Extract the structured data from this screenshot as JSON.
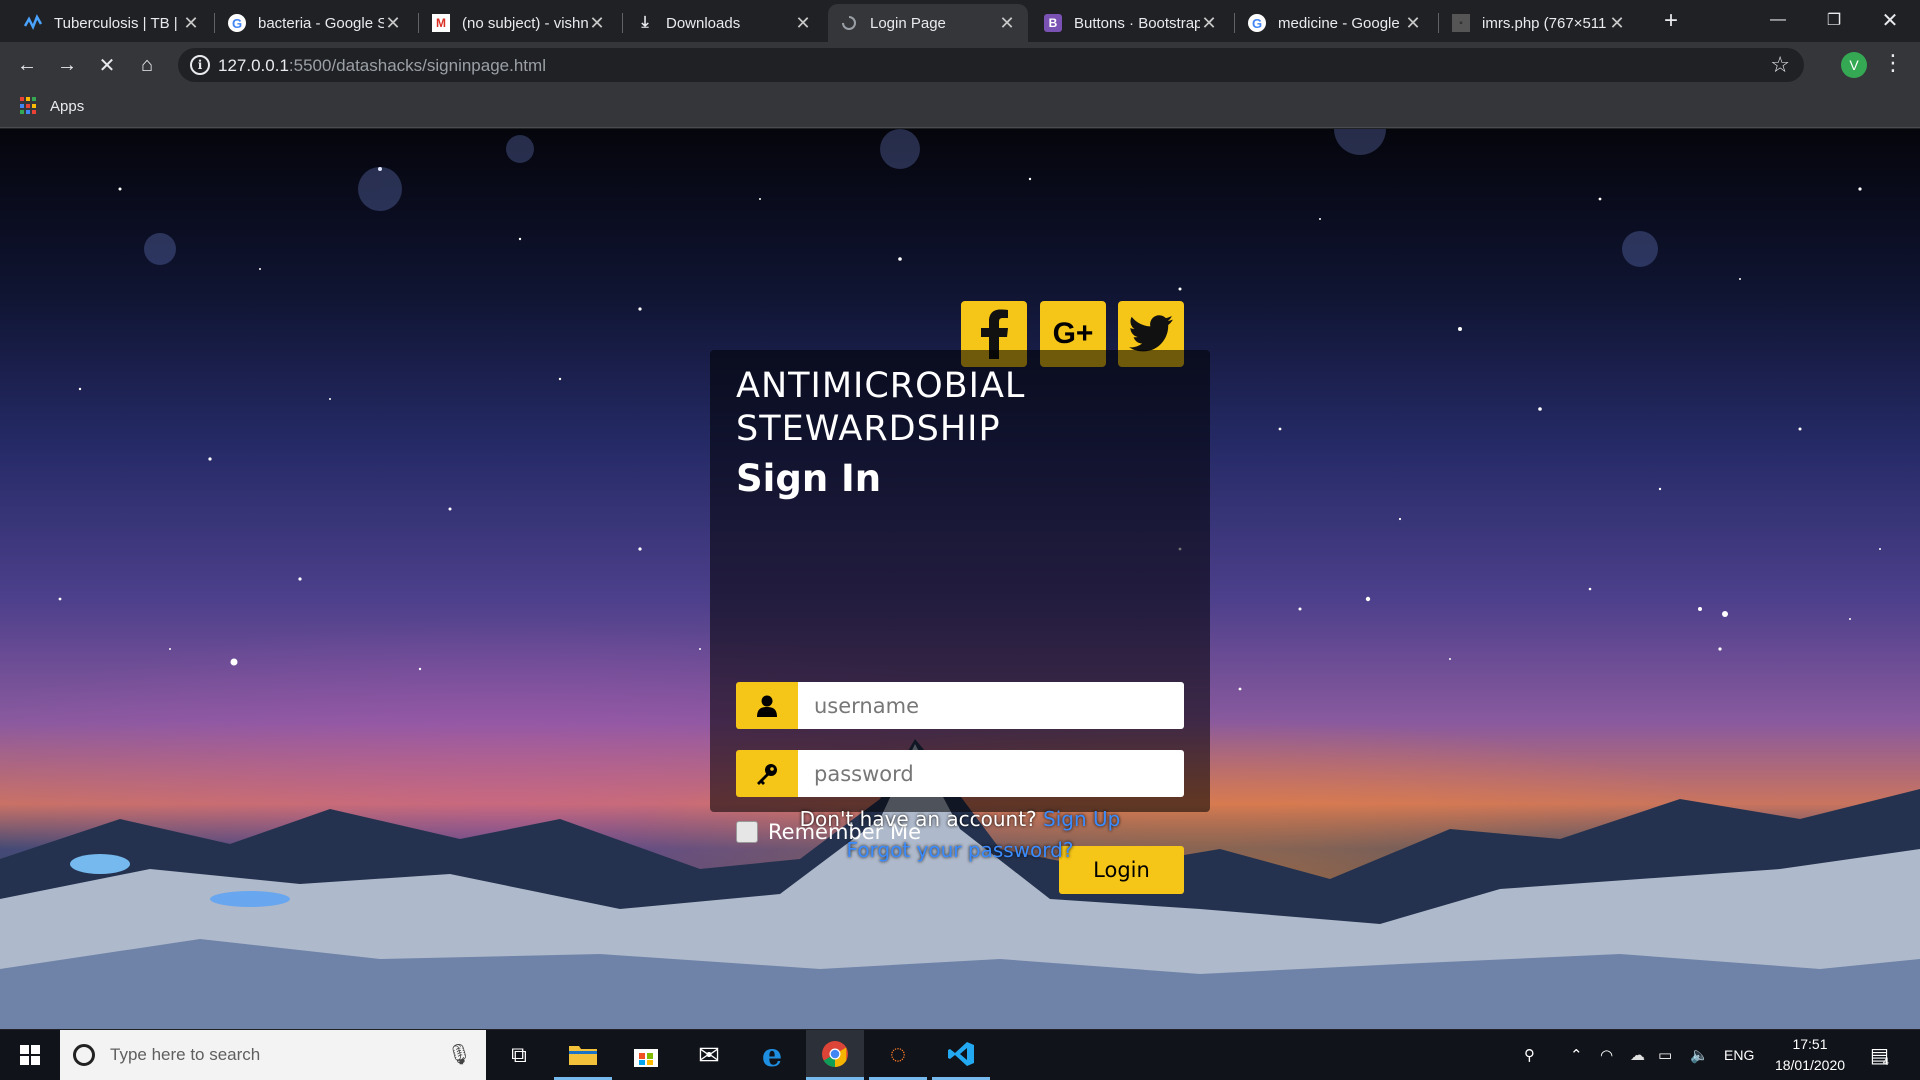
{
  "browser": {
    "tabs": [
      {
        "title": "Tuberculosis | TB |",
        "icon": "chart-icon"
      },
      {
        "title": "bacteria - Google S",
        "icon": "google-icon"
      },
      {
        "title": "(no subject) - vishn",
        "icon": "gmail-icon"
      },
      {
        "title": "Downloads",
        "icon": "download-icon"
      },
      {
        "title": "Login Page",
        "icon": "loading-icon"
      },
      {
        "title": "Buttons · Bootstrap",
        "icon": "bootstrap-icon"
      },
      {
        "title": "medicine - Google",
        "icon": "google-icon"
      },
      {
        "title": "imrs.php (767×511",
        "icon": "page-icon"
      }
    ],
    "active_tab_index": 4,
    "url_host": "127.0.0.1",
    "url_rest": ":5500/datashacks/signinpage.html",
    "profile_initial": "V",
    "bookmark_apps_label": "Apps"
  },
  "page": {
    "brand": "ANTIMICROBIAL STEWARDSHIP",
    "heading": "Sign In",
    "username_placeholder": "username",
    "password_placeholder": "password",
    "remember_label": "Remember Me",
    "login_label": "Login",
    "no_account_text": "Don't have an account?",
    "signup_label": "Sign Up",
    "forgot_label": "Forgot your password?",
    "social": {
      "gplus_label": "G+"
    },
    "accent_color": "#f5c518"
  },
  "taskbar": {
    "search_placeholder": "Type here to search",
    "language": "ENG",
    "time": "17:51",
    "date": "18/01/2020",
    "notifications_count": "4"
  }
}
